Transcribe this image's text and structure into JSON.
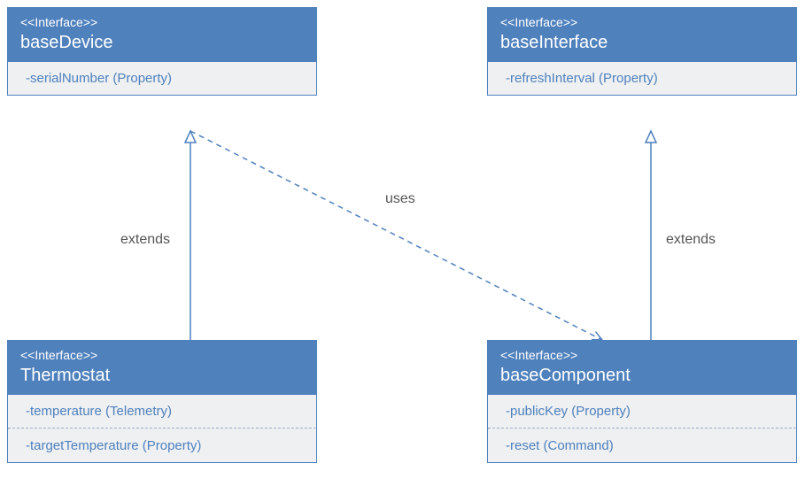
{
  "diagram": {
    "stereotype": "<<Interface>>",
    "boxes": {
      "baseDevice": {
        "name": "baseDevice",
        "members": {
          "m0": "-serialNumber (Property)"
        }
      },
      "baseInterface": {
        "name": "baseInterface",
        "members": {
          "m0": "-refreshInterval (Property)"
        }
      },
      "thermostat": {
        "name": "Thermostat",
        "members": {
          "m0": "-temperature (Telemetry)",
          "m1": "-targetTemperature (Property)"
        }
      },
      "baseComponent": {
        "name": "baseComponent",
        "members": {
          "m0": "-publicKey (Property)",
          "m1": "-reset (Command)"
        }
      }
    },
    "relations": {
      "extends1": "extends",
      "extends2": "extends",
      "uses": "uses"
    }
  },
  "colors": {
    "accent": "#4f81bd",
    "panel": "#eef0f2"
  }
}
